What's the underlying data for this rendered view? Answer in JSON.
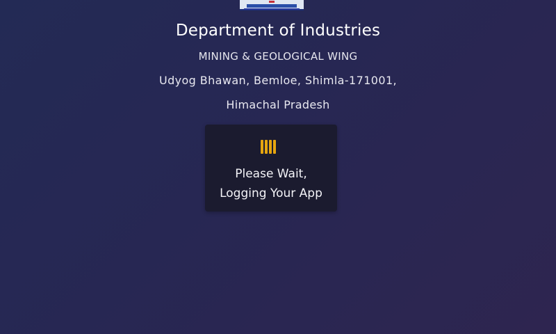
{
  "header": {
    "title": "Department of Industries",
    "subtitle": "MINING & GEOLOGICAL WING",
    "address_line1": "Udyog Bhawan, Bemloe, Shimla-171001,",
    "address_line2": "Himachal Pradesh"
  },
  "loader": {
    "icon": "loading-bars-icon",
    "accent_color": "#e6a50f",
    "line1": "Please Wait,",
    "line2": "Logging Your App"
  },
  "colors": {
    "background_start": "#232a55",
    "background_end": "#2e2550",
    "card": "#1b1b2f"
  }
}
